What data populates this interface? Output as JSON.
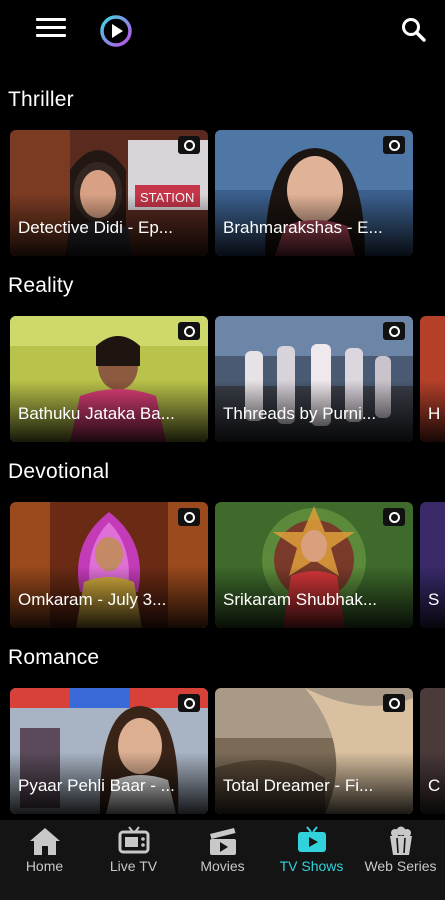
{
  "header": {
    "menu_icon": "hamburger-menu-icon",
    "logo_icon": "play-logo-icon",
    "search_icon": "search-icon"
  },
  "sections": [
    {
      "title": "Thriller",
      "cards": [
        {
          "title": "Detective Didi - Ep..."
        },
        {
          "title": "Brahmarakshas - E..."
        }
      ]
    },
    {
      "title": "Reality",
      "cards": [
        {
          "title": "Bathuku Jataka Ba..."
        },
        {
          "title": "Thhreads by Purni..."
        },
        {
          "title": "H"
        }
      ]
    },
    {
      "title": "Devotional",
      "cards": [
        {
          "title": "Omkaram - July 3..."
        },
        {
          "title": "Srikaram Shubhak..."
        },
        {
          "title": "S"
        }
      ]
    },
    {
      "title": "Romance",
      "cards": [
        {
          "title": "Pyaar Pehli Baar - ..."
        },
        {
          "title": "Total Dreamer - Fi..."
        },
        {
          "title": "C"
        }
      ]
    }
  ],
  "bottom_nav": {
    "items": [
      {
        "label": "Home",
        "icon": "home-icon"
      },
      {
        "label": "Live TV",
        "icon": "tv-icon"
      },
      {
        "label": "Movies",
        "icon": "clapperboard-icon"
      },
      {
        "label": "TV Shows",
        "icon": "tv-shows-icon"
      },
      {
        "label": "Web Series",
        "icon": "popcorn-icon"
      }
    ],
    "active_label": "TV Shows",
    "active_color": "#32d2dc"
  },
  "colors": {
    "background": "#000000",
    "accent": "#32d2dc",
    "nav_background": "#141414"
  }
}
